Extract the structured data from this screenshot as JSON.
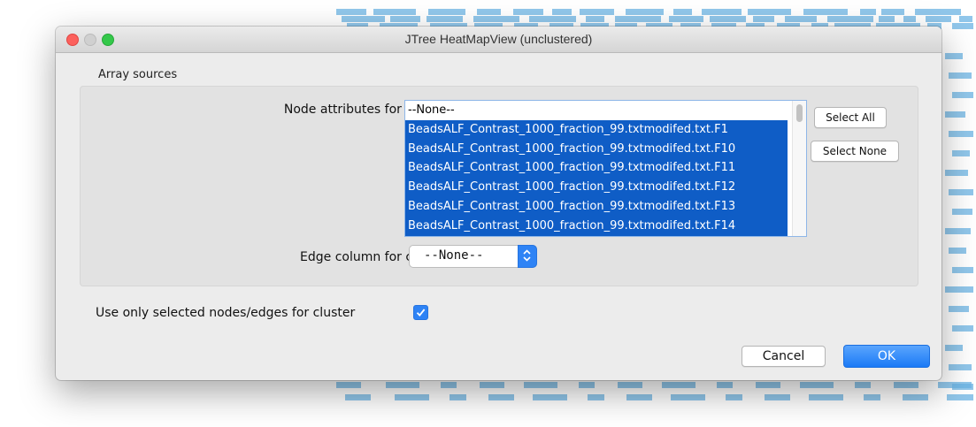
{
  "window": {
    "title": "JTree HeatMapView (unclustered)"
  },
  "section": {
    "label": "Array sources"
  },
  "node_attributes": {
    "label": "Node attributes for cluster",
    "items": [
      {
        "text": "--None--",
        "selected": false
      },
      {
        "text": "BeadsALF_Contrast_1000_fraction_99.txtmodifed.txt.F1",
        "selected": true
      },
      {
        "text": "BeadsALF_Contrast_1000_fraction_99.txtmodifed.txt.F10",
        "selected": true
      },
      {
        "text": "BeadsALF_Contrast_1000_fraction_99.txtmodifed.txt.F11",
        "selected": true
      },
      {
        "text": "BeadsALF_Contrast_1000_fraction_99.txtmodifed.txt.F12",
        "selected": true
      },
      {
        "text": "BeadsALF_Contrast_1000_fraction_99.txtmodifed.txt.F13",
        "selected": true
      },
      {
        "text": "BeadsALF_Contrast_1000_fraction_99.txtmodifed.txt.F14",
        "selected": true
      }
    ],
    "select_all_label": "Select All",
    "select_none_label": "Select None"
  },
  "edge_column": {
    "label": "Edge column for cluster",
    "selected_value": "--None--"
  },
  "use_only_selected": {
    "label": "Use only selected nodes/edges for cluster",
    "checked": true
  },
  "buttons": {
    "cancel_label": "Cancel",
    "ok_label": "OK"
  },
  "colors": {
    "accent": "#2e83f5",
    "selection": "#0f5dc6",
    "heatmap_tile": "#6cb4e4"
  }
}
